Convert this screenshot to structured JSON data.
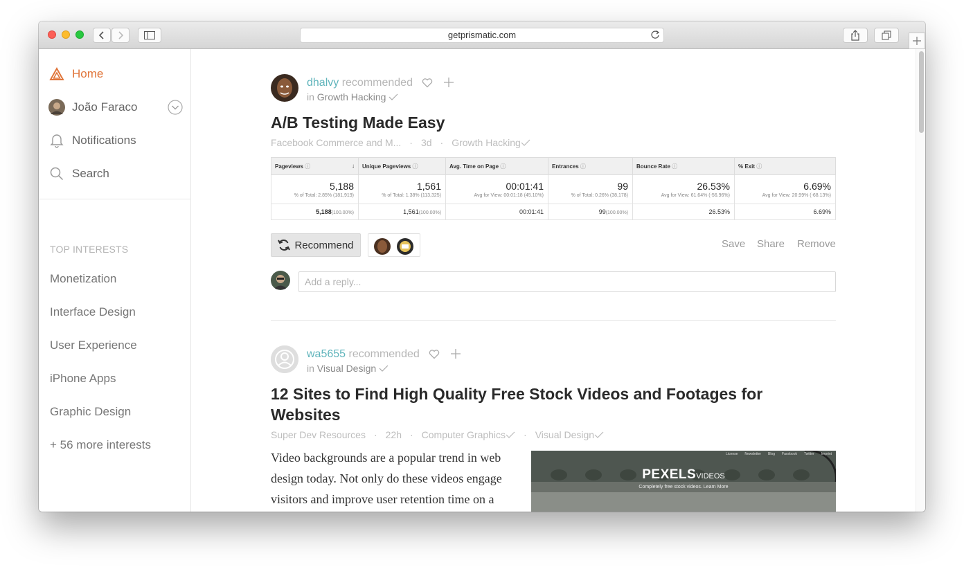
{
  "browser": {
    "url": "getprismatic.com"
  },
  "sidebar": {
    "home_label": "Home",
    "user_name": "João Faraco",
    "notifications_label": "Notifications",
    "search_label": "Search",
    "interests_header": "TOP INTERESTS",
    "interests": [
      "Monetization",
      "Interface Design",
      "User Experience",
      "iPhone Apps",
      "Graphic Design"
    ],
    "more_interests": "+ 56 more interests"
  },
  "posts": [
    {
      "user": "dhalvy",
      "action": "recommended",
      "in_prefix": "in",
      "topic": "Growth Hacking",
      "title": "A/B Testing Made Easy",
      "source": "Facebook Commerce and M...",
      "age": "3d",
      "tags": [
        "Growth Hacking"
      ],
      "table": {
        "headers": [
          "Pageviews",
          "Unique Pageviews",
          "Avg. Time on Page",
          "Entrances",
          "Bounce Rate",
          "% Exit"
        ],
        "values": [
          "5,188",
          "1,561",
          "00:01:41",
          "99",
          "26.53%",
          "6.69%"
        ],
        "subs": [
          "% of Total: 2.85% (181,919)",
          "% of Total: 1.38% (113,325)",
          "Avg for View: 00:01:18 (45.10%)",
          "% of Total: 0.26% (38,178)",
          "Avg for View: 61.64% (-56.96%)",
          "Avg for View: 20.99% (-68.13%)"
        ],
        "row": [
          "5,188",
          "1,561",
          "00:01:41",
          "99",
          "26.53%",
          "6.69%"
        ],
        "row_pcts": [
          "(100.00%)",
          "(100.00%)",
          "",
          "(100.00%)",
          "",
          ""
        ]
      },
      "recommend_label": "Recommend",
      "save_label": "Save",
      "share_label": "Share",
      "remove_label": "Remove",
      "reply_placeholder": "Add a reply..."
    },
    {
      "user": "wa5655",
      "action": "recommended",
      "in_prefix": "in",
      "topic": "Visual Design",
      "title": "12 Sites to Find High Quality Free Stock Videos and Footages for Websites",
      "source": "Super Dev Resources",
      "age": "22h",
      "tags": [
        "Computer Graphics",
        "Visual Design"
      ],
      "excerpt": "Video backgrounds are a popular trend in web design today. Not only do these videos engage visitors and improve user retention time on a",
      "thumb_brand": "PEXELS",
      "thumb_brand_suffix": "VIDEOS",
      "thumb_tagline": "Completely free stock videos. Learn More",
      "thumb_nav": [
        "License",
        "Newsletter",
        "Blog",
        "Facebook",
        "Twitter",
        "Imprint"
      ]
    }
  ],
  "colors": {
    "accent": "#e0753a",
    "link_user": "#5fb4bb"
  }
}
